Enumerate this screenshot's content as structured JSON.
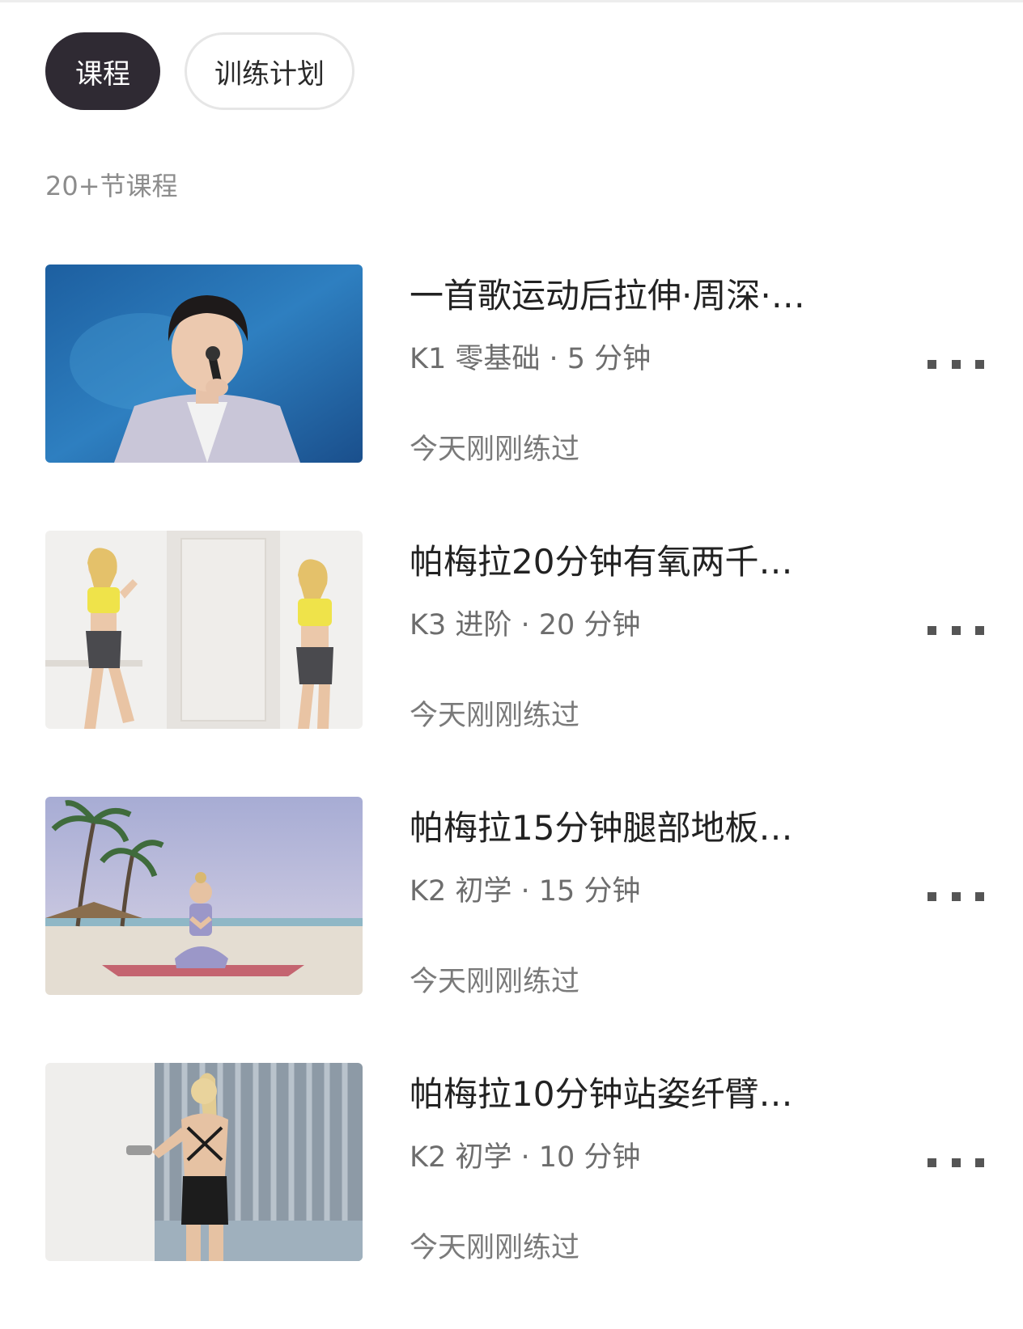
{
  "tabs": [
    {
      "label": "课程",
      "active": true
    },
    {
      "label": "训练计划",
      "active": false
    }
  ],
  "course_count": "20+节课程",
  "courses": [
    {
      "title": "一首歌运动后拉伸·周深·…",
      "meta": "K1 零基础 · 5 分钟",
      "status": "今天刚刚练过",
      "thumbnail": "singer-on-stage"
    },
    {
      "title": "帕梅拉20分钟有氧两千…",
      "meta": "K3 进阶 · 20 分钟",
      "status": "今天刚刚练过",
      "thumbnail": "two-women-exercising-white-wall"
    },
    {
      "title": "帕梅拉15分钟腿部地板…",
      "meta": "K2 初学 · 15 分钟",
      "status": "今天刚刚练过",
      "thumbnail": "woman-sitting-on-beach-mat"
    },
    {
      "title": "帕梅拉10分钟站姿纤臂…",
      "meta": "K2 初学 · 10 分钟",
      "status": "今天刚刚练过",
      "thumbnail": "woman-with-dumbbells-by-wall"
    }
  ],
  "colors": {
    "active_tab_bg": "#2f2a33",
    "title_text": "#222222",
    "secondary_text": "#6d6d6d"
  },
  "icons": {
    "more": "more-dots-icon"
  }
}
